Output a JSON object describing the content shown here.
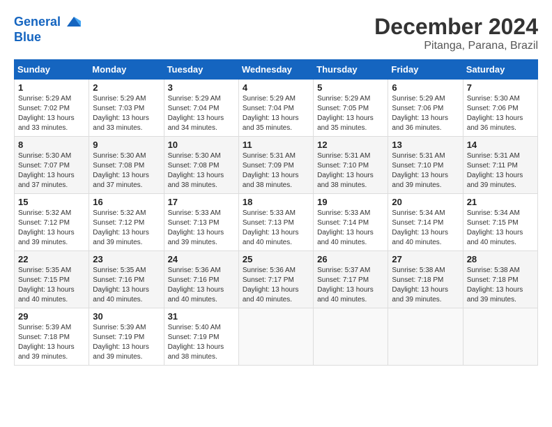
{
  "header": {
    "logo_line1": "General",
    "logo_line2": "Blue",
    "month": "December 2024",
    "location": "Pitanga, Parana, Brazil"
  },
  "weekdays": [
    "Sunday",
    "Monday",
    "Tuesday",
    "Wednesday",
    "Thursday",
    "Friday",
    "Saturday"
  ],
  "weeks": [
    [
      {
        "day": "1",
        "sunrise": "5:29 AM",
        "sunset": "7:02 PM",
        "daylight": "13 hours and 33 minutes."
      },
      {
        "day": "2",
        "sunrise": "5:29 AM",
        "sunset": "7:03 PM",
        "daylight": "13 hours and 33 minutes."
      },
      {
        "day": "3",
        "sunrise": "5:29 AM",
        "sunset": "7:04 PM",
        "daylight": "13 hours and 34 minutes."
      },
      {
        "day": "4",
        "sunrise": "5:29 AM",
        "sunset": "7:04 PM",
        "daylight": "13 hours and 35 minutes."
      },
      {
        "day": "5",
        "sunrise": "5:29 AM",
        "sunset": "7:05 PM",
        "daylight": "13 hours and 35 minutes."
      },
      {
        "day": "6",
        "sunrise": "5:29 AM",
        "sunset": "7:06 PM",
        "daylight": "13 hours and 36 minutes."
      },
      {
        "day": "7",
        "sunrise": "5:30 AM",
        "sunset": "7:06 PM",
        "daylight": "13 hours and 36 minutes."
      }
    ],
    [
      {
        "day": "8",
        "sunrise": "5:30 AM",
        "sunset": "7:07 PM",
        "daylight": "13 hours and 37 minutes."
      },
      {
        "day": "9",
        "sunrise": "5:30 AM",
        "sunset": "7:08 PM",
        "daylight": "13 hours and 37 minutes."
      },
      {
        "day": "10",
        "sunrise": "5:30 AM",
        "sunset": "7:08 PM",
        "daylight": "13 hours and 38 minutes."
      },
      {
        "day": "11",
        "sunrise": "5:31 AM",
        "sunset": "7:09 PM",
        "daylight": "13 hours and 38 minutes."
      },
      {
        "day": "12",
        "sunrise": "5:31 AM",
        "sunset": "7:10 PM",
        "daylight": "13 hours and 38 minutes."
      },
      {
        "day": "13",
        "sunrise": "5:31 AM",
        "sunset": "7:10 PM",
        "daylight": "13 hours and 39 minutes."
      },
      {
        "day": "14",
        "sunrise": "5:31 AM",
        "sunset": "7:11 PM",
        "daylight": "13 hours and 39 minutes."
      }
    ],
    [
      {
        "day": "15",
        "sunrise": "5:32 AM",
        "sunset": "7:12 PM",
        "daylight": "13 hours and 39 minutes."
      },
      {
        "day": "16",
        "sunrise": "5:32 AM",
        "sunset": "7:12 PM",
        "daylight": "13 hours and 39 minutes."
      },
      {
        "day": "17",
        "sunrise": "5:33 AM",
        "sunset": "7:13 PM",
        "daylight": "13 hours and 39 minutes."
      },
      {
        "day": "18",
        "sunrise": "5:33 AM",
        "sunset": "7:13 PM",
        "daylight": "13 hours and 40 minutes."
      },
      {
        "day": "19",
        "sunrise": "5:33 AM",
        "sunset": "7:14 PM",
        "daylight": "13 hours and 40 minutes."
      },
      {
        "day": "20",
        "sunrise": "5:34 AM",
        "sunset": "7:14 PM",
        "daylight": "13 hours and 40 minutes."
      },
      {
        "day": "21",
        "sunrise": "5:34 AM",
        "sunset": "7:15 PM",
        "daylight": "13 hours and 40 minutes."
      }
    ],
    [
      {
        "day": "22",
        "sunrise": "5:35 AM",
        "sunset": "7:15 PM",
        "daylight": "13 hours and 40 minutes."
      },
      {
        "day": "23",
        "sunrise": "5:35 AM",
        "sunset": "7:16 PM",
        "daylight": "13 hours and 40 minutes."
      },
      {
        "day": "24",
        "sunrise": "5:36 AM",
        "sunset": "7:16 PM",
        "daylight": "13 hours and 40 minutes."
      },
      {
        "day": "25",
        "sunrise": "5:36 AM",
        "sunset": "7:17 PM",
        "daylight": "13 hours and 40 minutes."
      },
      {
        "day": "26",
        "sunrise": "5:37 AM",
        "sunset": "7:17 PM",
        "daylight": "13 hours and 40 minutes."
      },
      {
        "day": "27",
        "sunrise": "5:38 AM",
        "sunset": "7:18 PM",
        "daylight": "13 hours and 39 minutes."
      },
      {
        "day": "28",
        "sunrise": "5:38 AM",
        "sunset": "7:18 PM",
        "daylight": "13 hours and 39 minutes."
      }
    ],
    [
      {
        "day": "29",
        "sunrise": "5:39 AM",
        "sunset": "7:18 PM",
        "daylight": "13 hours and 39 minutes."
      },
      {
        "day": "30",
        "sunrise": "5:39 AM",
        "sunset": "7:19 PM",
        "daylight": "13 hours and 39 minutes."
      },
      {
        "day": "31",
        "sunrise": "5:40 AM",
        "sunset": "7:19 PM",
        "daylight": "13 hours and 38 minutes."
      },
      null,
      null,
      null,
      null
    ]
  ]
}
